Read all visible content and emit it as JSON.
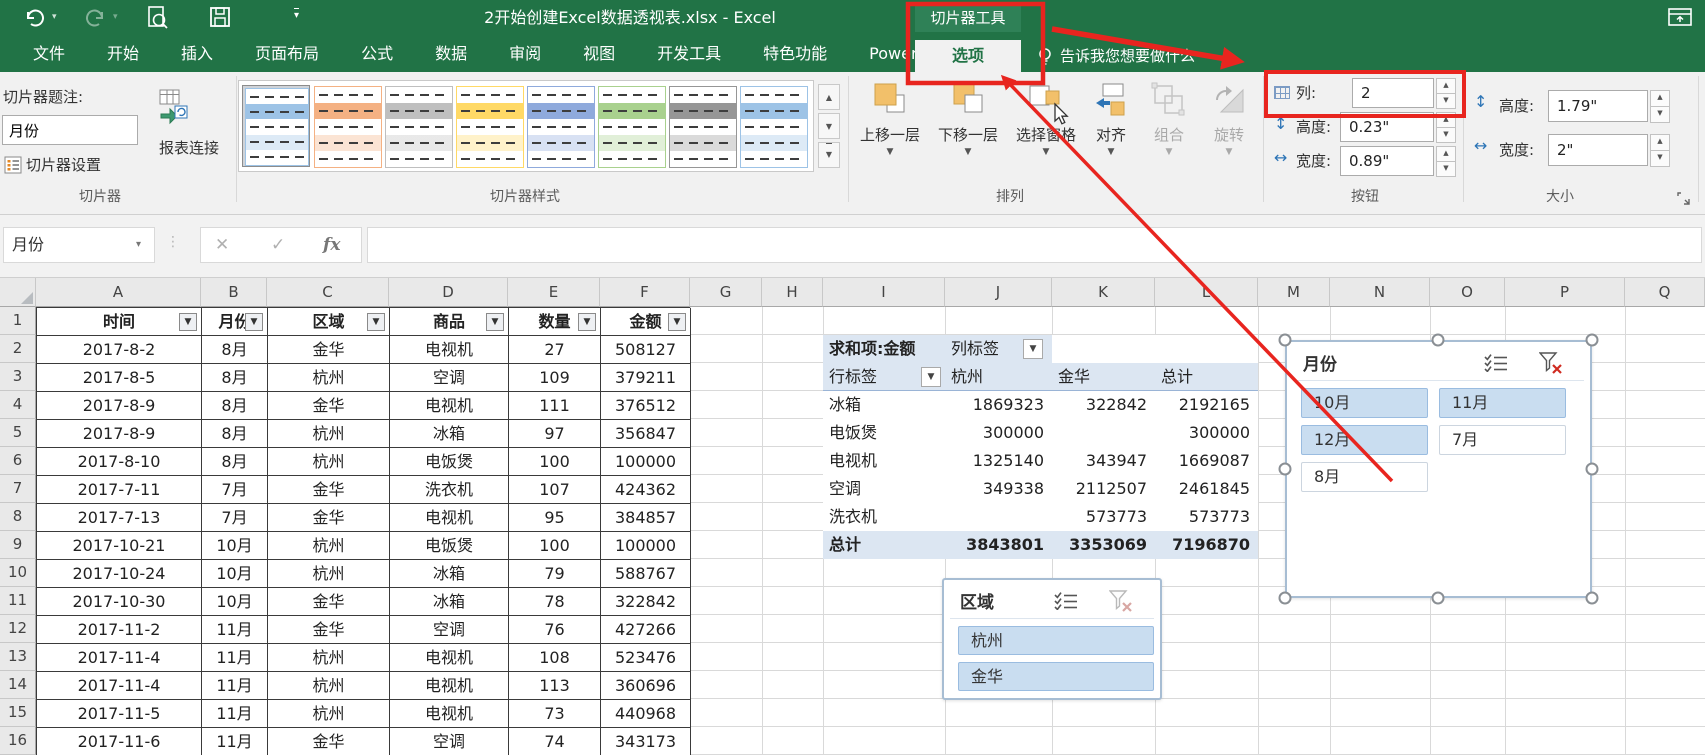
{
  "title_bar": {
    "document_title": "2开始创建Excel数据透视表.xlsx - Excel",
    "contextual_tool_label": "切片器工具"
  },
  "ribbon_tabs": {
    "items": [
      "文件",
      "开始",
      "插入",
      "页面布局",
      "公式",
      "数据",
      "审阅",
      "视图",
      "开发工具",
      "特色功能",
      "Power Pivot"
    ],
    "contextual_tab": "选项",
    "tell_me": "告诉我您想要做什么"
  },
  "ribbon": {
    "slicer_group": {
      "caption_label": "切片器题注:",
      "caption_value": "月份",
      "settings_button": "切片器设置",
      "report_connections_button": "报表连接",
      "group_name": "切片器"
    },
    "styles_group": {
      "group_name": "切片器样式",
      "style_accents": [
        "#9dc3e6",
        "#f4b183",
        "#bfbfbf",
        "#ffd966",
        "#8faadc",
        "#a9d18e",
        "#969696",
        "#9dc3e6"
      ]
    },
    "arrange_group": {
      "group_name": "排列",
      "bring_forward": "上移一层",
      "send_backward": "下移一层",
      "selection_pane": "选择窗格",
      "align": "对齐",
      "group": "组合",
      "rotate": "旋转"
    },
    "buttons_group": {
      "group_name": "按钮",
      "fields": [
        {
          "label": "列:",
          "value": "2",
          "icon": "columns-icon"
        },
        {
          "label": "高度:",
          "value": "0.23\"",
          "icon": "height-icon"
        },
        {
          "label": "宽度:",
          "value": "0.89\"",
          "icon": "width-icon"
        }
      ]
    },
    "size_group": {
      "group_name": "大小",
      "fields": [
        {
          "label": "高度:",
          "value": "1.79\"",
          "icon": "height-icon"
        },
        {
          "label": "宽度:",
          "value": "2\"",
          "icon": "width-icon"
        }
      ]
    }
  },
  "formula_bar": {
    "name_box_value": "月份",
    "fx_label": "fx",
    "formula_value": ""
  },
  "sheet": {
    "column_letters": [
      "A",
      "B",
      "C",
      "D",
      "E",
      "F",
      "G",
      "H",
      "I",
      "J",
      "K",
      "L",
      "M",
      "N",
      "O",
      "P",
      "Q"
    ],
    "row_count": 16,
    "table": {
      "headers": [
        "时间",
        "月份",
        "区域",
        "商品",
        "数量",
        "金额"
      ],
      "rows": [
        [
          "2017-8-2",
          "8月",
          "金华",
          "电视机",
          "27",
          "508127"
        ],
        [
          "2017-8-5",
          "8月",
          "杭州",
          "空调",
          "109",
          "379211"
        ],
        [
          "2017-8-9",
          "8月",
          "金华",
          "电视机",
          "111",
          "376512"
        ],
        [
          "2017-8-9",
          "8月",
          "杭州",
          "冰箱",
          "97",
          "356847"
        ],
        [
          "2017-8-10",
          "8月",
          "杭州",
          "电饭煲",
          "100",
          "100000"
        ],
        [
          "2017-7-11",
          "7月",
          "金华",
          "洗衣机",
          "107",
          "424362"
        ],
        [
          "2017-7-13",
          "7月",
          "金华",
          "电视机",
          "95",
          "384857"
        ],
        [
          "2017-10-21",
          "10月",
          "杭州",
          "电饭煲",
          "100",
          "100000"
        ],
        [
          "2017-10-24",
          "10月",
          "杭州",
          "冰箱",
          "79",
          "588767"
        ],
        [
          "2017-10-30",
          "10月",
          "金华",
          "冰箱",
          "78",
          "322842"
        ],
        [
          "2017-11-2",
          "11月",
          "金华",
          "空调",
          "76",
          "427266"
        ],
        [
          "2017-11-4",
          "11月",
          "杭州",
          "电视机",
          "108",
          "523476"
        ],
        [
          "2017-11-4",
          "11月",
          "杭州",
          "电视机",
          "113",
          "360696"
        ],
        [
          "2017-11-5",
          "11月",
          "杭州",
          "电视机",
          "73",
          "440968"
        ],
        [
          "2017-11-6",
          "11月",
          "金华",
          "空调",
          "74",
          "343173"
        ]
      ]
    },
    "pivot": {
      "value_field": "求和项:金额",
      "col_header": "列标签",
      "row_header": "行标签",
      "columns": [
        "杭州",
        "金华",
        "总计"
      ],
      "rows": [
        {
          "label": "冰箱",
          "values": [
            "1869323",
            "322842",
            "2192165"
          ]
        },
        {
          "label": "电饭煲",
          "values": [
            "300000",
            "",
            "300000"
          ]
        },
        {
          "label": "电视机",
          "values": [
            "1325140",
            "343947",
            "1669087"
          ]
        },
        {
          "label": "空调",
          "values": [
            "349338",
            "2112507",
            "2461845"
          ]
        },
        {
          "label": "洗衣机",
          "values": [
            "",
            "573773",
            "573773"
          ]
        }
      ],
      "grand_total": {
        "label": "总计",
        "values": [
          "3843801",
          "3353069",
          "7196870"
        ]
      }
    }
  },
  "slicers": {
    "month": {
      "title": "月份",
      "buttons": [
        {
          "label": "10月",
          "selected": true
        },
        {
          "label": "11月",
          "selected": true
        },
        {
          "label": "12月",
          "selected": true
        },
        {
          "label": "7月",
          "selected": false
        },
        {
          "label": "8月",
          "selected": false
        }
      ]
    },
    "region": {
      "title": "区域",
      "buttons": [
        {
          "label": "杭州",
          "selected": true
        },
        {
          "label": "金华",
          "selected": true
        }
      ]
    }
  },
  "colors": {
    "excel_green": "#217346",
    "contextual_green": "#2f8157",
    "annotation_red": "#e8251f",
    "slicer_selected_fill": "#c9ddf0",
    "pivot_header_fill": "#dce6f2"
  }
}
